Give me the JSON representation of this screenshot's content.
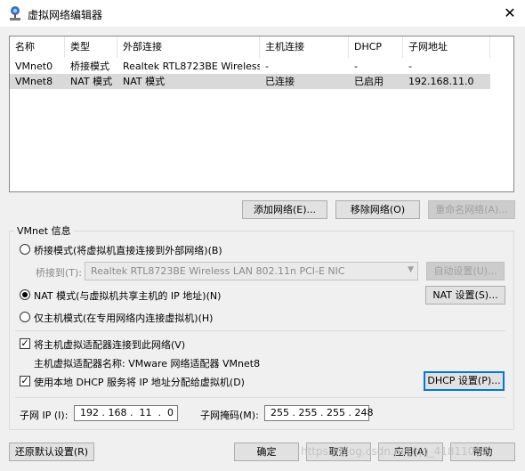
{
  "window": {
    "title": "虚拟网络编辑器",
    "close_glyph": "✕"
  },
  "columns": [
    "名称",
    "类型",
    "外部连接",
    "主机连接",
    "DHCP",
    "子网地址"
  ],
  "rows": [
    {
      "name": "VMnet0",
      "type": "桥接模式",
      "external": "Realtek RTL8723BE Wireless...",
      "host": "-",
      "dhcp": "-",
      "subnet": "-",
      "selected": false
    },
    {
      "name": "VMnet8",
      "type": "NAT 模式",
      "external": "NAT 模式",
      "host": "已连接",
      "dhcp": "已启用",
      "subnet": "192.168.11.0",
      "selected": true
    }
  ],
  "list_buttons": {
    "add": "添加网络(E)...",
    "remove": "移除网络(O)",
    "rename": "重命名网络(A)..."
  },
  "vmnet_info": {
    "group_label": "VMnet 信息",
    "bridged_label": "桥接模式(将虚拟机直接连接到外部网络)(B)",
    "bridge_to_label": "桥接到(T):",
    "bridge_to_value": "Realtek RTL8723BE Wireless LAN 802.11n PCI-E NIC",
    "auto_settings": "自动设置(U)...",
    "nat_label": "NAT 模式(与虚拟机共享主机的 IP 地址)(N)",
    "nat_settings": "NAT 设置(S)...",
    "hostonly_label": "仅主机模式(在专用网络内连接虚拟机)(H)",
    "selected_mode": "nat",
    "connect_adapter_label": "将主机虚拟适配器连接到此网络(V)",
    "connect_adapter_checked": true,
    "adapter_name_label": "主机虚拟适配器名称: VMware 网络适配器 VMnet8",
    "dhcp_label": "使用本地 DHCP 服务将 IP 地址分配给虚拟机(D)",
    "dhcp_checked": true,
    "dhcp_settings": "DHCP 设置(P)...",
    "subnet_ip_label": "子网 IP (I):",
    "subnet_ip_value": "192 . 168 .  11  .  0",
    "subnet_mask_label": "子网掩码(M):",
    "subnet_mask_value": "255 . 255 . 255 . 248"
  },
  "bottom_buttons": {
    "restore": "还原默认设置(R)",
    "ok": "确定",
    "cancel": "取消",
    "apply": "应用(A)",
    "help": "帮助"
  },
  "watermark": "https://blog.csdn.net/qq_41811092"
}
